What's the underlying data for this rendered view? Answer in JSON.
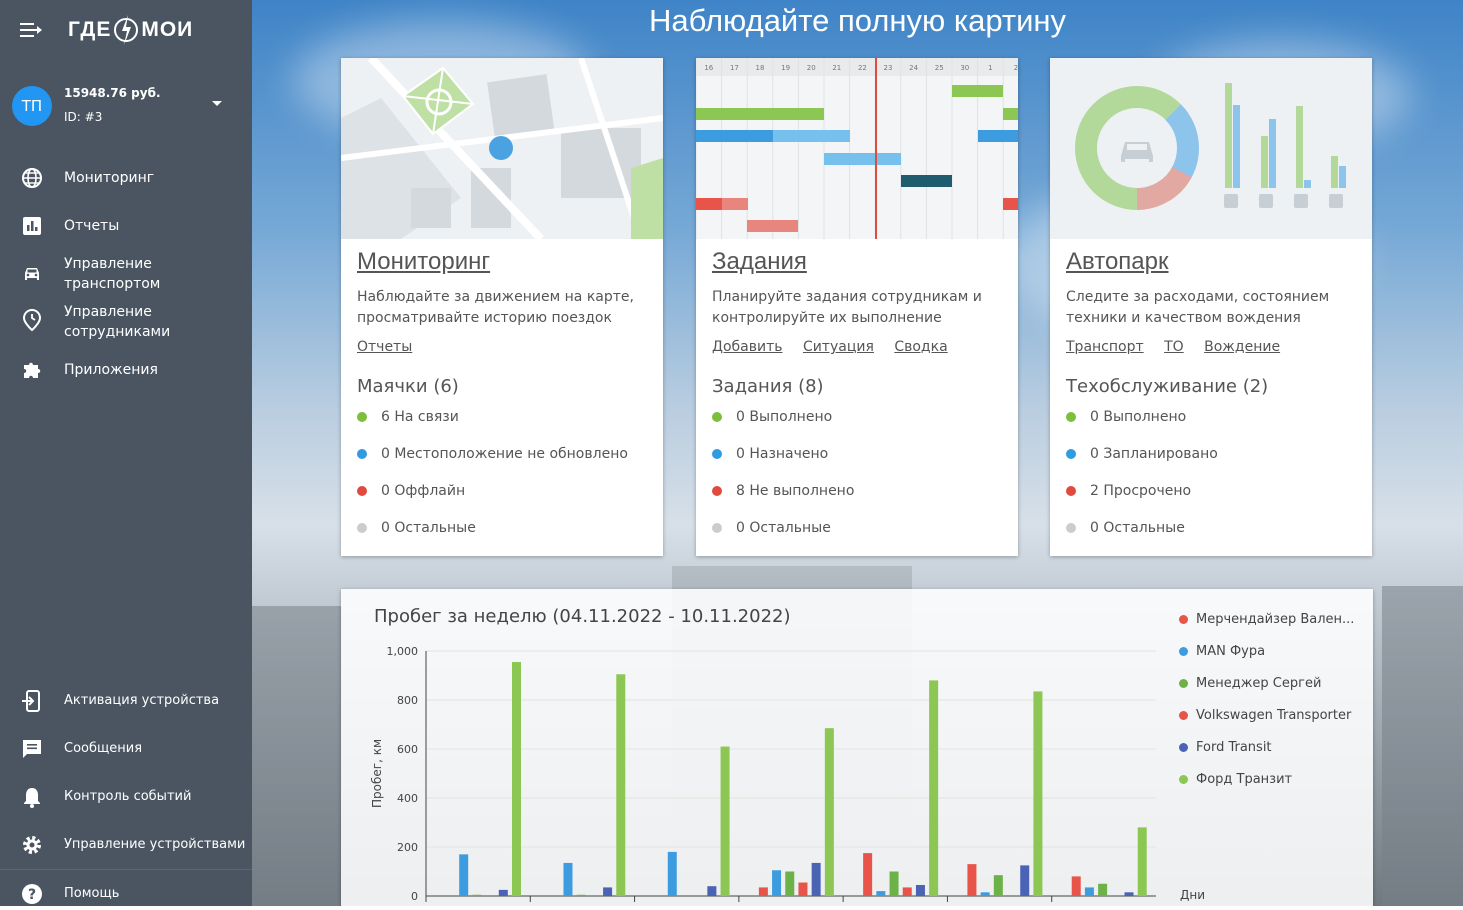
{
  "sidebar": {
    "logo_left": "ГДЕ",
    "logo_right": "МОИ",
    "user": {
      "initials": "ТП",
      "balance": "15948.76 руб.",
      "id": "ID: #3"
    },
    "items": [
      {
        "label_1": "Мониторинг",
        "label_2": ""
      },
      {
        "label_1": "Отчеты",
        "label_2": ""
      },
      {
        "label_1": "Управление",
        "label_2": "транспортом"
      },
      {
        "label_1": "Управление",
        "label_2": "сотрудниками"
      },
      {
        "label_1": "Приложения",
        "label_2": ""
      }
    ],
    "bottom_items": [
      {
        "label": "Активация устройства"
      },
      {
        "label": "Сообщения"
      },
      {
        "label": "Контроль событий"
      },
      {
        "label": "Управление устройствами"
      },
      {
        "label": "Помощь"
      }
    ]
  },
  "main": {
    "title": "Наблюдайте полную картину",
    "cards": [
      {
        "title": "Мониторинг",
        "desc": "Наблюдайте за движением на карте, просматривайте историю поездок",
        "links": [
          "Отчеты"
        ],
        "stat_head": "Маячки (6)",
        "stats": [
          "6 На связи",
          "0 Местоположение не обновлено",
          "0 Оффлайн",
          "0 Остальные"
        ]
      },
      {
        "title": "Задания",
        "desc": "Планируйте задания сотрудникам и контролируйте их выполнение",
        "links": [
          "Добавить",
          "Ситуация",
          "Сводка"
        ],
        "stat_head": "Задания (8)",
        "stats": [
          "0 Выполнено",
          "0 Назначено",
          "8 Не выполнено",
          "0 Остальные"
        ],
        "gantt_days": [
          "16",
          "17",
          "18",
          "19",
          "20",
          "21",
          "22",
          "23",
          "24",
          "25",
          "30",
          "1",
          "2"
        ]
      },
      {
        "title": "Автопарк",
        "desc": "Следите за расходами, состоянием техники и качеством вождения",
        "links": [
          "Транспорт",
          "ТО",
          "Вождение"
        ],
        "stat_head": "Техобслуживание (2)",
        "stats": [
          "0 Выполнено",
          "0 Запланировано",
          "2 Просрочено",
          "0 Остальные"
        ]
      }
    ],
    "status_colors": [
      "#7cbf3c",
      "#2f9be0",
      "#e04b3f",
      "#cccccc"
    ]
  },
  "chart_data": {
    "type": "bar",
    "title": "Пробег за неделю (04.11.2022 - 10.11.2022)",
    "ylabel": "Пробег, км",
    "xlabel": "Дни",
    "ylim": [
      0,
      1000
    ],
    "yticks": [
      "0",
      "200",
      "400",
      "600",
      "800",
      "1,000"
    ],
    "categories": [
      "",
      "",
      "",
      "",
      "",
      "",
      ""
    ],
    "series": [
      {
        "name": "Мерчендайзер Вален...",
        "color": "#e8534a",
        "values": [
          0,
          0,
          0,
          35,
          175,
          130,
          80
        ]
      },
      {
        "name": "MAN Фура",
        "color": "#3d9be0",
        "values": [
          170,
          135,
          180,
          105,
          20,
          15,
          35
        ]
      },
      {
        "name": "Менеджер Сергей",
        "color": "#6cb248",
        "values": [
          5,
          5,
          0,
          100,
          100,
          85,
          50
        ]
      },
      {
        "name": "Volkswagen Transporter",
        "color": "#e8534a",
        "values": [
          0,
          0,
          0,
          55,
          35,
          0,
          0
        ]
      },
      {
        "name": "Ford Transit",
        "color": "#4a63b5",
        "values": [
          25,
          35,
          40,
          135,
          45,
          125,
          15
        ]
      },
      {
        "name": "Форд Транзит",
        "color": "#8bc752",
        "values": [
          955,
          905,
          610,
          685,
          880,
          835,
          280
        ]
      }
    ]
  }
}
